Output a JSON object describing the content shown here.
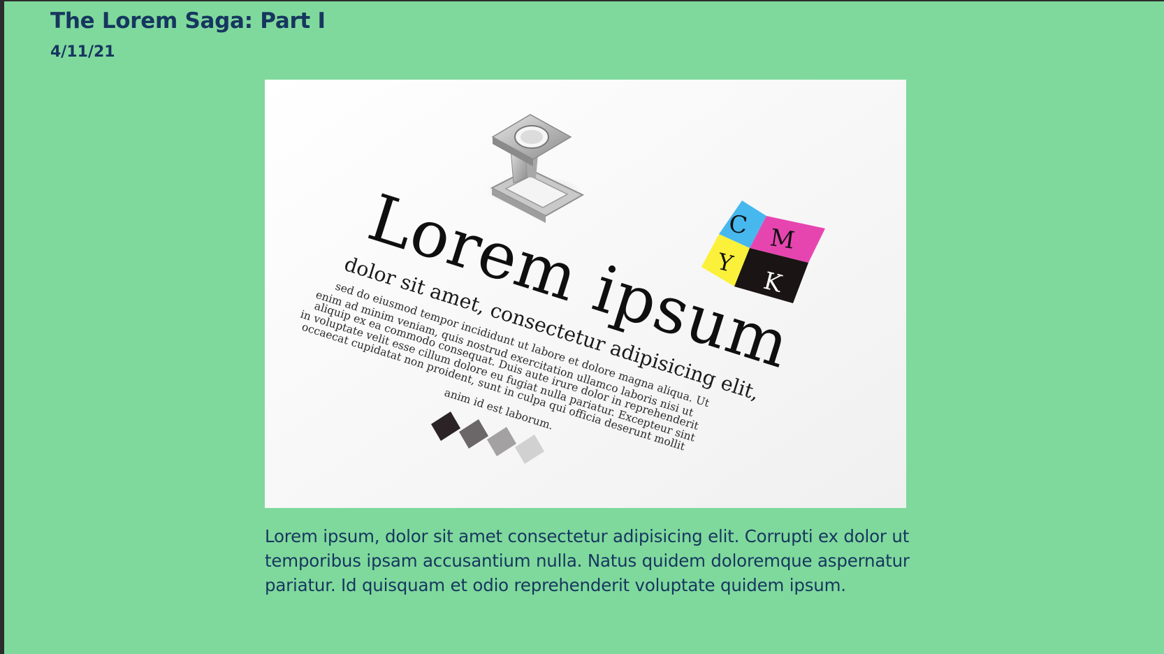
{
  "post": {
    "title": "The Lorem Saga: Part I",
    "date": "4/11/21",
    "body": "Lorem ipsum, dolor sit amet consectetur adipisicing elit. Corrupti ex dolor ut temporibus ipsam accusantium nulla. Natus quidem doloremque aspernatur pariatur. Id quisquam et odio reprehenderit voluptate quidem ipsum."
  },
  "hero_image": {
    "headline": "Lorem ipsum",
    "subhead": "dolor sit amet, consectetur adipisicing elit,",
    "body_lines": [
      "sed do eiusmod tempor incididunt ut labore et dolore magna aliqua. Ut",
      "enim ad minim veniam, quis nostrud exercitation ullamco laboris nisi ut",
      "aliquip ex ea commodo consequat. Duis aute irure dolor in reprehenderit",
      "in voluptate velit esse cillum dolore eu fugiat nulla pariatur. Excepteur sint",
      "occaecat cupidatat non proident, sunt in culpa qui officia deserunt mollit",
      "anim id est laborum."
    ],
    "cmyk": {
      "c": "C",
      "m": "M",
      "y": "Y",
      "k": "K"
    },
    "colors": {
      "cyan": "#46b8ee",
      "magenta": "#e645b0",
      "yellow": "#fbf13a",
      "black": "#1a1414"
    }
  },
  "colors": {
    "page_background": "#7fd99c",
    "text": "#16365f"
  }
}
